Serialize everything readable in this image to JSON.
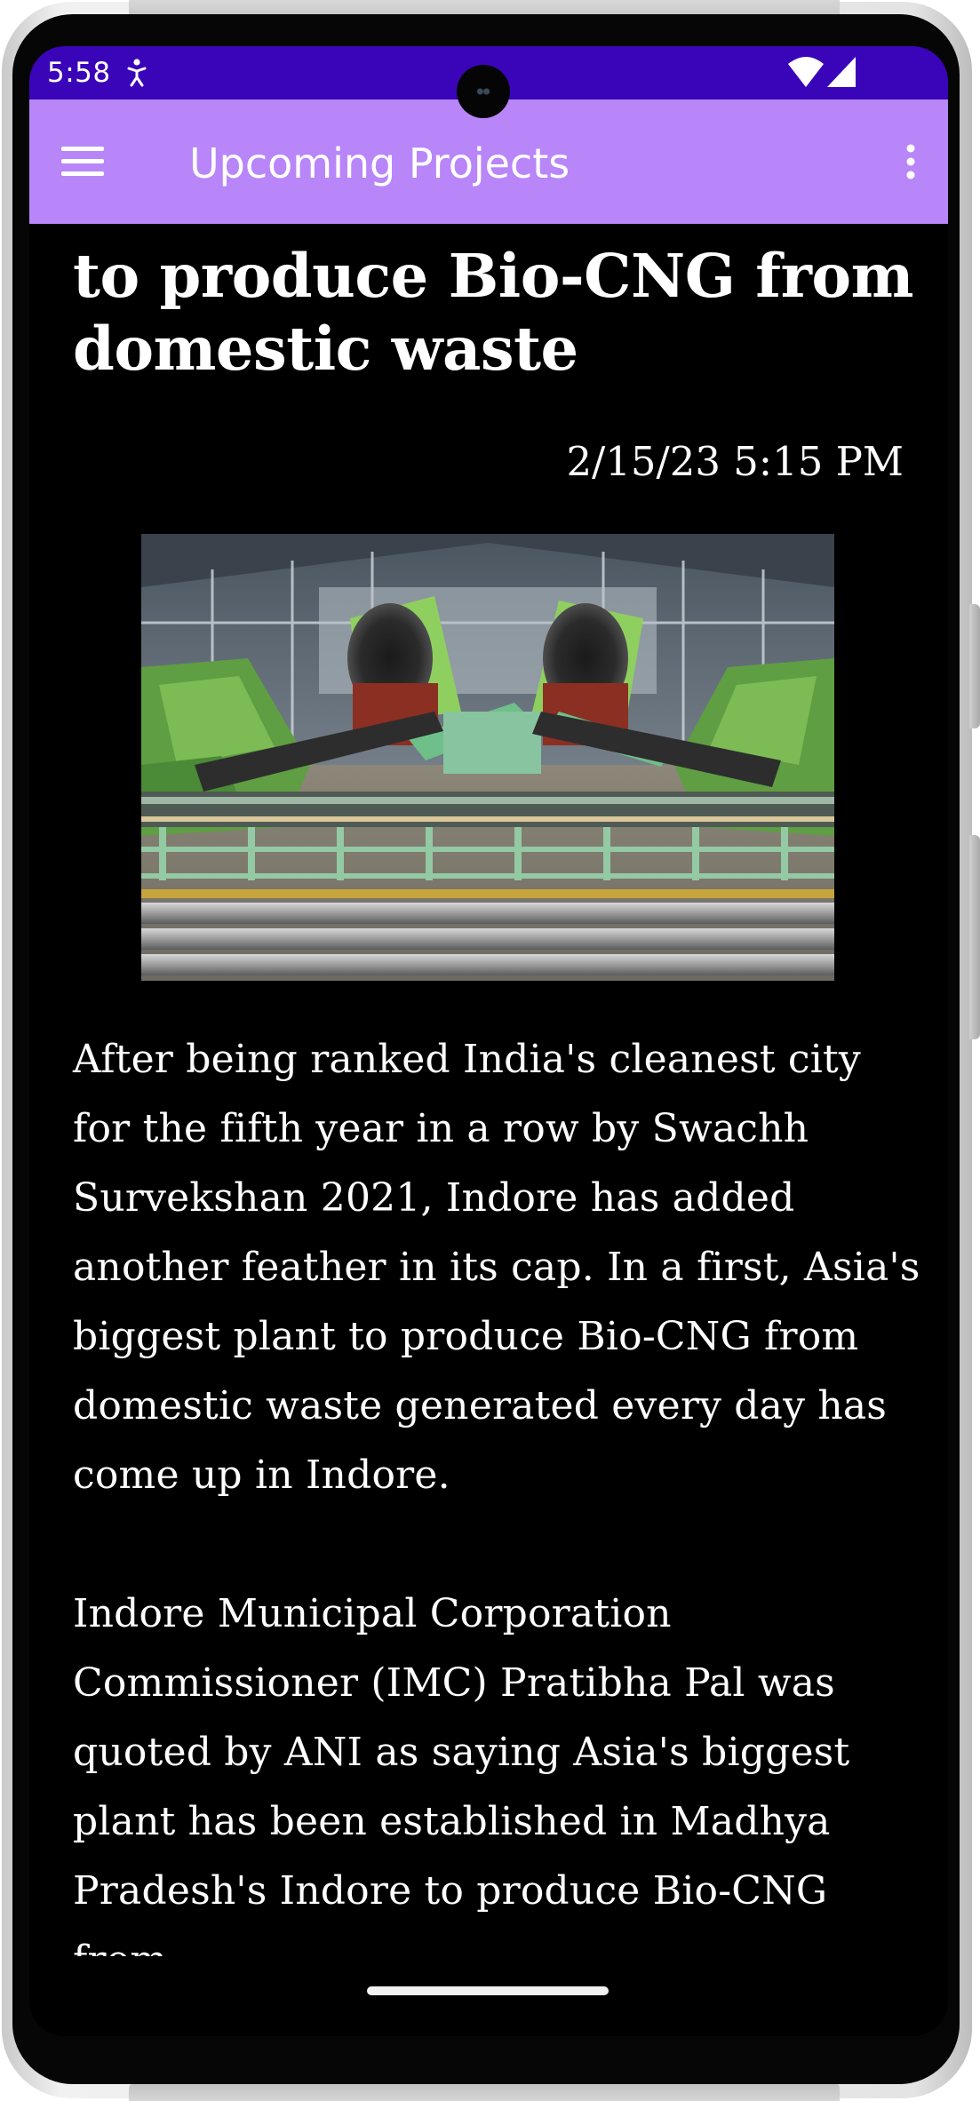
{
  "status_bar": {
    "time": "5:58",
    "notification_icon": "accessibility-person-icon",
    "wifi_icon": "wifi-icon",
    "signal_icon": "cell-signal-icon"
  },
  "app_bar": {
    "title": "Upcoming Projects",
    "menu_icon": "hamburger-menu-icon",
    "overflow_icon": "more-vertical-icon",
    "background_color": "#b886f8"
  },
  "article": {
    "headline": "to produce Bio-CNG from domestic waste",
    "timestamp": "2/15/23 5:15 PM",
    "photo_subject": "biogas-plant-photo",
    "paragraphs": [
      "After being ranked India's cleanest city\nfor the fifth year in a row by Swachh\nSurvekshan 2021, Indore has added\nanother feather in its cap. In a first, Asia's\nbiggest plant to produce Bio-CNG from\ndomestic waste generated every day has\ncome up in Indore.",
      "Indore Municipal Corporation\nCommissioner (IMC) Pratibha Pal was\nquoted by ANI as saying Asia's biggest\nplant has been established in Madhya\nPradesh's Indore to produce Bio-CNG from\ndomestic waste generated every day in the"
    ]
  },
  "colors": {
    "status_bar": "#3a05b8",
    "content_background": "#000000",
    "content_text": "#ffffff"
  }
}
